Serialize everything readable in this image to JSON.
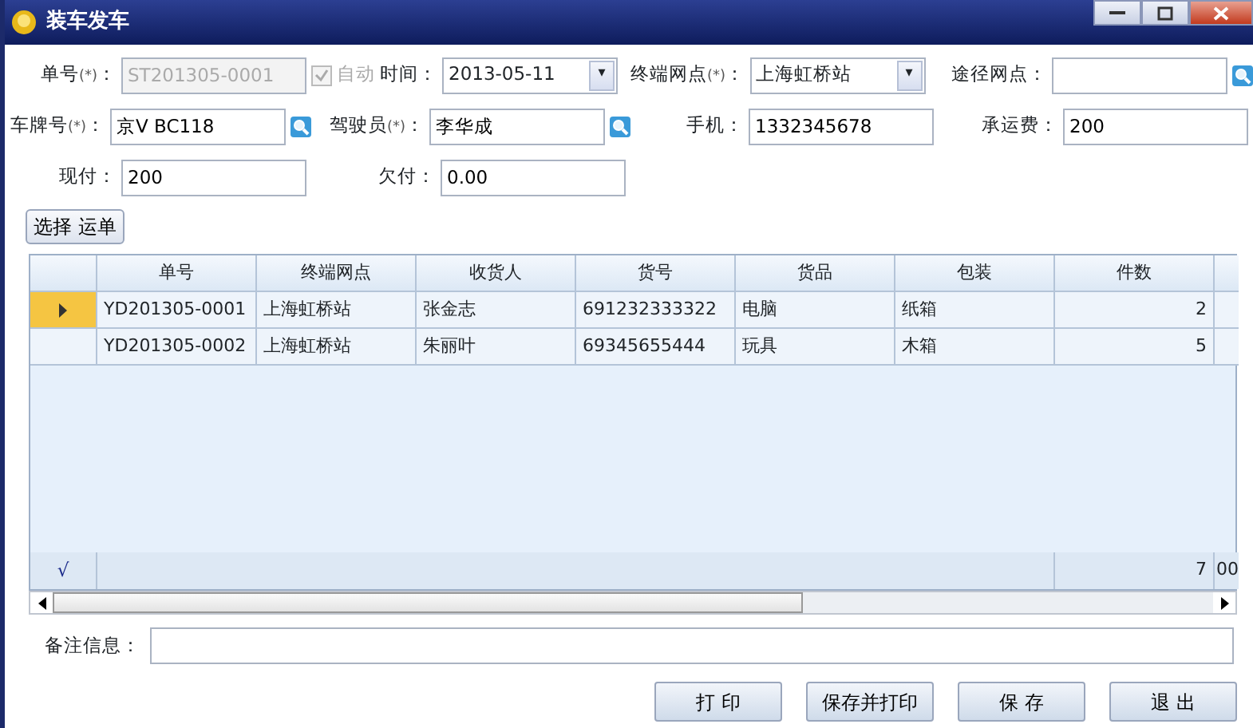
{
  "window": {
    "title": "装车发车"
  },
  "form": {
    "rows": [
      [
        {
          "kind": "text",
          "label": "单号",
          "marker": "(*)",
          "colon": "：",
          "value": "ST201305-0001",
          "disabled": true,
          "lookup": false,
          "auto_checkbox": {
            "label": "自动",
            "checked": true,
            "disabled": true
          }
        },
        {
          "kind": "combo",
          "label": "时间",
          "colon": "：",
          "value": "2013-05-11",
          "caret": "▾"
        },
        {
          "kind": "combo",
          "label": "终端网点",
          "marker": "(*)",
          "colon": "：",
          "value": "上海虹桥站",
          "caret": "▾"
        },
        {
          "kind": "text",
          "label": "途径网点",
          "colon": "：",
          "disabled": false,
          "lookup": true
        }
      ],
      [
        {
          "kind": "text",
          "label": "车牌号",
          "marker": "(*)",
          "colon": "：",
          "value": "京V BC118",
          "disabled": false,
          "lookup": true
        },
        {
          "kind": "text",
          "label": "驾驶员",
          "marker": "(*)",
          "colon": "：",
          "value": "李华成",
          "disabled": false,
          "lookup": true
        },
        {
          "kind": "text",
          "label": "手机",
          "colon": "：",
          "value": "1332345678",
          "disabled": false,
          "lookup": false
        },
        {
          "kind": "text",
          "label": "承运费",
          "colon": "：",
          "value": "200",
          "disabled": false,
          "lookup": false
        }
      ],
      [
        {
          "kind": "text",
          "label": "现付",
          "colon": "：",
          "value": "200",
          "disabled": false,
          "lookup": false
        },
        {
          "kind": "text",
          "label": "欠付",
          "colon": "：",
          "value": "0.00",
          "disabled": false,
          "lookup": false
        }
      ]
    ]
  },
  "select_button": "选择 运单",
  "table": {
    "columns": [
      "单号",
      "终端网点",
      "收货人",
      "货号",
      "货品",
      "包装",
      "件数"
    ],
    "rows": [
      {
        "selected": true,
        "cells": [
          "YD201305-0001",
          "上海虹桥站",
          "张金志",
          "691232333322",
          "电脑",
          "纸箱",
          "2"
        ]
      },
      {
        "selected": false,
        "cells": [
          "YD201305-0002",
          "上海虹桥站",
          "朱丽叶",
          "69345655444",
          "玩具",
          "木箱",
          "5"
        ]
      }
    ],
    "footer": {
      "indicator": "√",
      "total": "7",
      "column_8": "00"
    }
  },
  "remarks": {
    "label": "备注信息："
  },
  "buttons": [
    "打 印",
    "保存并打印",
    "保 存",
    "退 出"
  ]
}
